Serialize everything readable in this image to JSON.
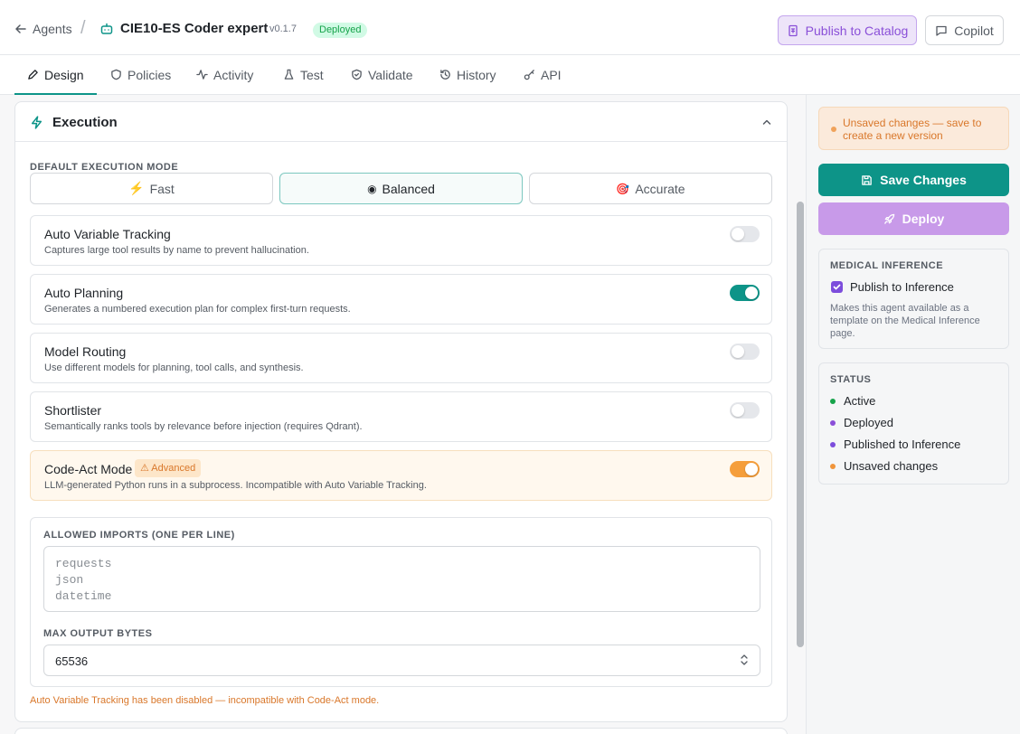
{
  "header": {
    "back_label": "Agents",
    "separator": "/",
    "agent_name": "CIE10-ES Coder expert",
    "version": "v0.1.7",
    "status_badge": "Deployed",
    "publish_label": "Publish to Catalog",
    "copilot_label": "Copilot"
  },
  "tabs": [
    {
      "label": "Design",
      "icon": "pencil-icon"
    },
    {
      "label": "Policies",
      "icon": "shield-icon"
    },
    {
      "label": "Activity",
      "icon": "activity-icon"
    },
    {
      "label": "Test",
      "icon": "flask-icon"
    },
    {
      "label": "Validate",
      "icon": "shield-check-icon"
    },
    {
      "label": "History",
      "icon": "history-icon"
    },
    {
      "label": "API",
      "icon": "key-icon"
    }
  ],
  "execution": {
    "title": "Execution",
    "mode_label": "DEFAULT EXECUTION MODE",
    "modes": [
      {
        "glyph": "⚡",
        "label": "Fast"
      },
      {
        "glyph": "◉",
        "label": "Balanced"
      },
      {
        "glyph": "🎯",
        "label": "Accurate"
      }
    ],
    "selected_mode": "Balanced",
    "toggles": [
      {
        "name": "Auto Variable Tracking",
        "desc": "Captures large tool results by name to prevent hallucination.",
        "on": false
      },
      {
        "name": "Auto Planning",
        "desc": "Generates a numbered execution plan for complex first-turn requests.",
        "on": true
      },
      {
        "name": "Model Routing",
        "desc": "Use different models for planning, tool calls, and synthesis.",
        "on": false
      },
      {
        "name": "Shortlister",
        "desc": "Semantically ranks tools by relevance before injection (requires Qdrant).",
        "on": false
      },
      {
        "name": "Code-Act Mode",
        "badge": "⚠ Advanced",
        "desc": "LLM-generated Python runs in a subprocess. Incompatible with Auto Variable Tracking.",
        "on": true
      }
    ],
    "imports_label": "ALLOWED IMPORTS (ONE PER LINE)",
    "imports_placeholder": "requests\njson\ndatetime",
    "max_bytes_label": "MAX OUTPUT BYTES",
    "max_bytes_value": "65536",
    "warning": "Auto Variable Tracking has been disabled — incompatible with Code-Act mode."
  },
  "sidebar": {
    "unsaved_notice": "Unsaved changes — save to create a new version",
    "save_label": "Save Changes",
    "deploy_label": "Deploy",
    "inference_header": "MEDICAL INFERENCE",
    "inference_checkbox": "Publish to Inference",
    "inference_checked": true,
    "inference_desc": "Makes this agent available as a template on the Medical Inference page.",
    "status_header": "STATUS",
    "status_items": [
      {
        "label": "Active",
        "color": "#16a34a"
      },
      {
        "label": "Deployed",
        "color": "#8b4fd8"
      },
      {
        "label": "Published to Inference",
        "color": "#7c4ddc"
      },
      {
        "label": "Unsaved changes",
        "color": "#f0953b"
      }
    ]
  },
  "colors": {
    "accent": "#0d9488",
    "purple": "#8a4fd8",
    "warning": "#d9772a"
  }
}
